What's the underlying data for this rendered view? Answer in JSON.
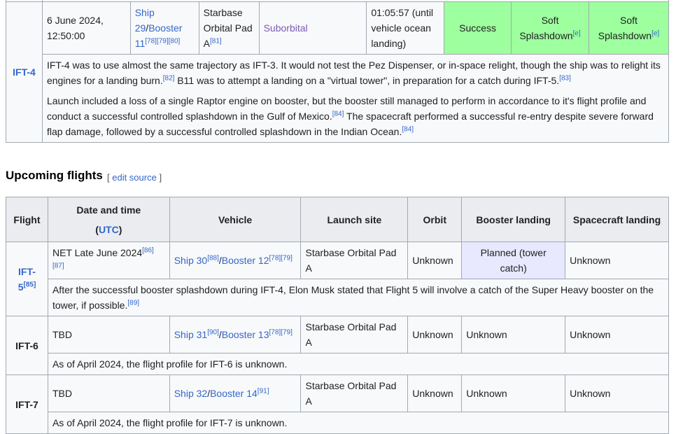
{
  "ift4": {
    "flight": "IFT-4",
    "date": "6 June 2024, 12:50:00",
    "ship": "Ship 29",
    "booster": "Booster 11",
    "vehicle_refs": "[78][79][80]",
    "site": "Starbase Orbital Pad A",
    "site_ref": "[81]",
    "orbit": "Suborbital",
    "duration": "01:05:57 (until vehicle ocean landing)",
    "outcome": "Success",
    "booster_landing": "Soft Splashdown",
    "booster_landing_ref": "[e]",
    "spacecraft_landing": "Soft Splashdown",
    "spacecraft_landing_ref": "[e]",
    "desc1_a": "IFT-4 was to use almost the same trajectory as IFT-3. It would not test the Pez Dispenser, or in-space relight, though the ship was to relight its engines for a landing burn.",
    "desc1_ref1": "[82]",
    "desc1_b": " B11 was to attempt a landing on a \"virtual tower\", in preparation for a catch during IFT-5.",
    "desc1_ref2": "[83]",
    "desc2_a": "Launch included a loss of a single Raptor engine on booster, but the booster still managed to perform in accordance to it's flight profile and conduct a successful controlled splashdown in the Gulf of Mexico.",
    "desc2_ref1": "[84]",
    "desc2_b": " The spacecraft performed a successful re-entry despite severe forward flap damage, followed by a successful controlled splashdown in the Indian Ocean.",
    "desc2_ref2": "[84]"
  },
  "upcoming": {
    "heading": "Upcoming flights",
    "edit_open": "[ ",
    "edit_label": "edit source",
    "edit_close": " ]",
    "headers": {
      "flight": "Flight",
      "date": "Date and time",
      "utc_open": "(",
      "utc": "UTC",
      "utc_close": ")",
      "vehicle": "Vehicle",
      "site": "Launch site",
      "orbit": "Orbit",
      "booster": "Booster landing",
      "spacecraft": "Spacecraft landing"
    },
    "rows": [
      {
        "flight": "IFT-5",
        "flight_ref": "[85]",
        "date": "NET Late June 2024",
        "date_ref": "[86][87]",
        "ship": "Ship 30",
        "ship_ref": "[88]",
        "booster": "Booster 12",
        "booster_ref": "[78][79]",
        "site": "Starbase Orbital Pad A",
        "orbit": "Unknown",
        "booster_landing": "Planned (tower catch)",
        "spacecraft_landing": "Unknown",
        "desc": "After the successful booster splashdown during IFT-4, Elon Musk stated that Flight 5 will involve a catch of the Super Heavy booster on the tower, if possible.",
        "desc_ref": "[89]"
      },
      {
        "flight": "IFT-6",
        "date": "TBD",
        "ship": "Ship 31",
        "ship_ref": "[90]",
        "booster": "Booster 13",
        "booster_ref": "[78][79]",
        "site": "Starbase Orbital Pad A",
        "orbit": "Unknown",
        "booster_landing": "Unknown",
        "spacecraft_landing": "Unknown",
        "desc": "As of April 2024, the flight profile for IFT-6 is unknown."
      },
      {
        "flight": "IFT-7",
        "date": "TBD",
        "ship": "Ship 32",
        "booster": "Booster 14",
        "booster_ref": "[91]",
        "site": "Starbase Orbital Pad A",
        "orbit": "Unknown",
        "booster_landing": "Unknown",
        "spacecraft_landing": "Unknown",
        "desc": "As of April 2024, the flight profile for IFT-7 is unknown."
      }
    ]
  },
  "colors": {
    "success": "#9eff9e",
    "planned": "#e8e8ff",
    "link": "#3366cc",
    "visited_link": "#795cb2",
    "border": "#a2a9b1",
    "header_bg": "#eaecf0"
  }
}
